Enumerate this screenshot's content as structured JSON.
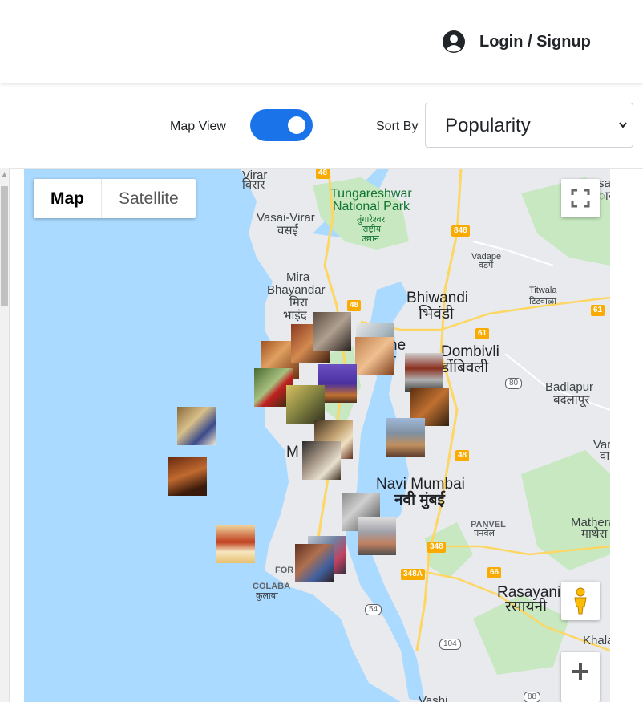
{
  "header": {
    "login_label": "Login / Signup"
  },
  "controls": {
    "map_view_label": "Map View",
    "map_view_on": true,
    "sort_label": "Sort By",
    "sort_value": "Popularity"
  },
  "map": {
    "type_buttons": [
      "Map",
      "Satellite"
    ],
    "labels": {
      "virar": "Virar",
      "virar_mr": "विरार",
      "tungareshwar": "Tungareshwar",
      "national_park": "National Park",
      "tung_mr1": "तुंगारेश्वर",
      "tung_mr2": "राष्ट्रीय",
      "tung_mr3": "उद्यान",
      "vasai": "Vasai-Virar",
      "vasai_mr": "वसई",
      "vadape": "Vadape",
      "vadape_mr": "वडपे",
      "mira": "Mira",
      "bhayandar": "Bhayandar",
      "mira_mr": "मिरा",
      "bhayandar_mr": "भाइंद",
      "bhiwandi": "Bhiwandi",
      "bhiwandi_mr": "भिवंडी",
      "titwala": "Titwala",
      "titwala_mr": "टिटवाळा",
      "thane_part": "he",
      "thane_mr_part": "णे",
      "dombivli": "Dombivli",
      "dombivli_mr": "डोंबिवली",
      "badlapur": "Badlapur",
      "badlapur_mr": "बदलापूर",
      "mumbai_part": "M",
      "navi_mumbai": "Navi Mumbai",
      "navi_mumbai_mr": "नवी मुंबई",
      "panvel": "PANVEL",
      "panvel_mr": "पनवेल",
      "matheran": "Mathera",
      "matheran_mr": "माथेरा",
      "fort": "FOR",
      "colaba": "COLABA",
      "colaba_mr": "कुलाबा",
      "rasayani": "Rasayani",
      "rasayani_mr": "रसायनी",
      "khala": "Khala",
      "vashi": "Vashi",
      "var": "Var",
      "var_mr": "वा",
      "sa": "sa",
      "sa_mr": "ास"
    },
    "shields": [
      "48",
      "848",
      "48",
      "61",
      "61",
      "48",
      "348",
      "348A",
      "66"
    ],
    "nh_shields": [
      "80",
      "54",
      "104",
      "88"
    ]
  },
  "colors": {
    "toggle": "#1a73e8",
    "water": "#aadaff",
    "land": "#e8eaed",
    "park": "#c7e8c0",
    "shield": "#f9ab00"
  }
}
